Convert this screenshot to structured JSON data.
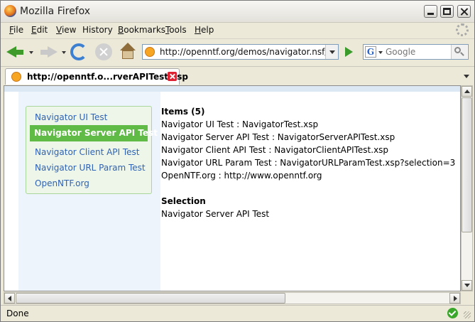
{
  "window": {
    "title": "Mozilla Firefox"
  },
  "menubar": [
    {
      "label": "File",
      "key": "F",
      "rest": "ile"
    },
    {
      "label": "Edit",
      "key": "E",
      "rest": "dit"
    },
    {
      "label": "View",
      "key": "V",
      "rest": "iew"
    },
    {
      "label": "History",
      "key": "",
      "rest": "History"
    },
    {
      "label": "Bookmarks",
      "key": "B",
      "rest": "ookmarks"
    },
    {
      "label": "Tools",
      "key": "T",
      "rest": "ools"
    },
    {
      "label": "Help",
      "key": "H",
      "rest": "elp"
    }
  ],
  "navbar": {
    "url": "http://openntf.org/demos/navigator.nsf/NavigatorServerAPITest.xsp",
    "search_placeholder": "Google",
    "search_engine_letter": "G"
  },
  "tab": {
    "label": "http://openntf.o...rverAPITest.xsp"
  },
  "page": {
    "nav": {
      "items": [
        "Navigator UI Test",
        "Navigator Server API Test",
        "Navigator Client API Test",
        "Navigator URL Param Test",
        "OpenNTF.org"
      ],
      "active": "Navigator Server API Test"
    },
    "items_heading": "Items (5)",
    "items": [
      "Navigator UI Test : NavigatorTest.xsp",
      "Navigator Server API Test : NavigatorServerAPITest.xsp",
      "Navigator Client API Test : NavigatorClientAPITest.xsp",
      "Navigator URL Param Test : NavigatorURLParamTest.xsp?selection=3",
      "OpenNTF.org : http://www.openntf.org"
    ],
    "selection_heading": "Selection",
    "selection_value": "Navigator Server API Test"
  },
  "status": {
    "text": "Done"
  },
  "colors": {
    "active_nav": "#5fba46",
    "link": "#2f63b5",
    "panel_border": "#a9d69a"
  }
}
